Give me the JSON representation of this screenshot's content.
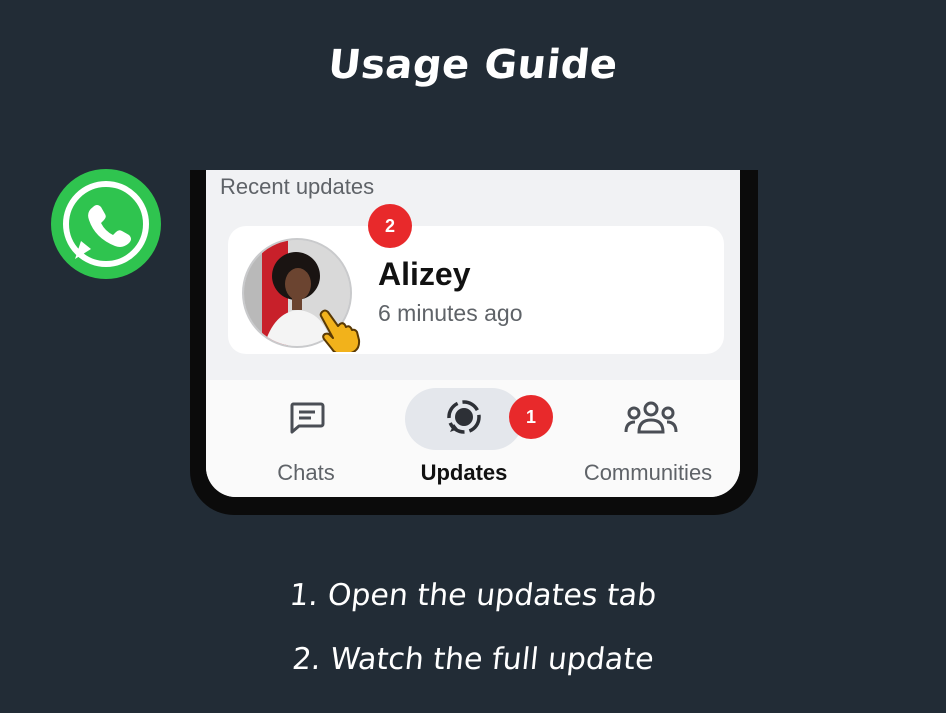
{
  "header": {
    "title": "Usage Guide"
  },
  "logo": {
    "icon": "whatsapp-icon",
    "color": "#2fc44f"
  },
  "updates_screen": {
    "section_label": "Recent updates",
    "status_card": {
      "name": "Alizey",
      "time": "6 minutes ago",
      "step_badge": "2"
    }
  },
  "bottom_nav": {
    "tabs": [
      {
        "label": "Chats",
        "icon": "chat-icon",
        "active": false
      },
      {
        "label": "Updates",
        "icon": "updates-icon",
        "active": true,
        "step_badge": "1"
      },
      {
        "label": "Communities",
        "icon": "communities-icon",
        "active": false
      }
    ]
  },
  "instructions": {
    "steps": [
      "1. Open the updates tab",
      "2. Watch the full update"
    ]
  },
  "colors": {
    "background": "#222c36",
    "badge": "#e8292b",
    "accent": "#2fc44f"
  }
}
